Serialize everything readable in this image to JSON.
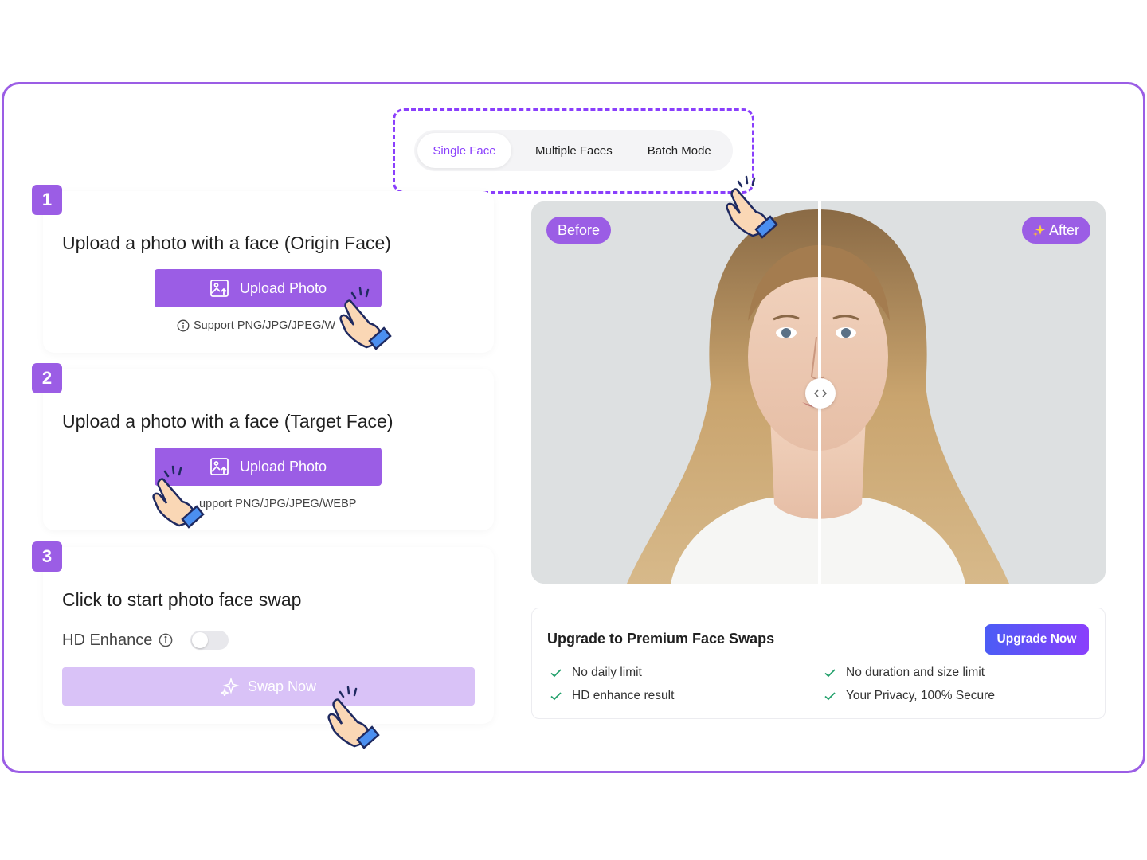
{
  "tabs": [
    {
      "label": "Single Face",
      "active": true
    },
    {
      "label": "Multiple Faces",
      "active": false
    },
    {
      "label": "Batch Mode",
      "active": false
    }
  ],
  "steps": [
    {
      "number": "1",
      "title": "Upload a photo with a face (Origin Face)",
      "button": "Upload Photo",
      "support": "Support PNG/JPG/JPEG/W"
    },
    {
      "number": "2",
      "title": "Upload a photo with a face (Target Face)",
      "button": "Upload Photo",
      "support": "upport PNG/JPG/JPEG/WEBP"
    },
    {
      "number": "3",
      "title": "Click to start photo face swap",
      "hd_label": "HD Enhance",
      "hd_enabled": false,
      "button": "Swap Now"
    }
  ],
  "preview": {
    "before_label": "Before",
    "after_label": "After"
  },
  "premium": {
    "title": "Upgrade to Premium Face Swaps",
    "button": "Upgrade Now",
    "features": [
      "No daily limit",
      "No duration and size limit",
      "HD enhance result",
      "Your Privacy, 100% Secure"
    ]
  },
  "colors": {
    "accent": "#9b5de5",
    "dashed_border": "#8a3ffc",
    "check": "#22a06b"
  }
}
